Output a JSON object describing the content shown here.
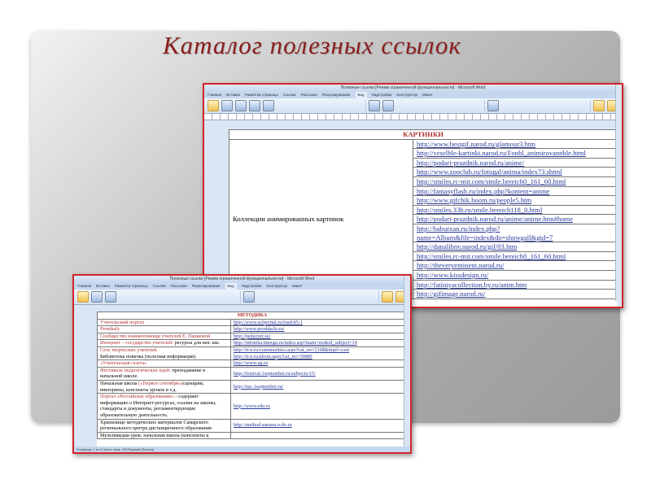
{
  "slide_title": "Каталог полезных ссылок",
  "window1": {
    "title": "Полезные ссылки [Режим ограниченной функциональности] - Microsoft Word",
    "tabs": [
      "Главная",
      "Вставка",
      "Разметка страницы",
      "Ссылки",
      "Рассылки",
      "Рецензирование",
      "Вид",
      "Надстройки",
      "Конструктор",
      "Макет"
    ],
    "active_tab": "Вид",
    "header": "КАРТИНКИ",
    "left_cell": "Коллекции анимированных картинок",
    "links": [
      "http://www.bestgif.narod.ru/glamour3.htm",
      "http://veselble-kartinki.narod.ru/Fonbl_animirovannble.html",
      "http://podari-prazdnik.narod.ru/anime/",
      "http://www.zooclub.ru/fotogal/anima/index73.shtml",
      "http://smiles.rc-mir.com/smile.bereich0_161_60.html",
      "http://fantasyflash.ru/index.php?kontent=anime",
      "http://www.gifchik.boom.ru/people5.htm",
      "http://smiles.33b.ru/smile.bereich118_0.html",
      "http://podari-prazdnik.narod.ru/anime/anime.htm#home",
      "http://baburxan.ru/index.php?name=Album&file=index&do=showgall&gid=7",
      "http://danalibnv.narod.ru/gif/03.htm",
      "http://smiles.rc-mir.com/smile.bereich0_161_60.html",
      "http://theveryeminent.narod.ru/",
      "http://www.kissdesign.ru/",
      "http://fatiniyacollection.by.ru/anim.htm",
      "http://gifimage.narod.ru/"
    ]
  },
  "window2": {
    "title": "Полезные ссылки [Режим ограниченной функциональности] - Microsoft Word",
    "tabs": [
      "Главная",
      "Вставка",
      "Разметка страницы",
      "Ссылки",
      "Рассылки",
      "Рецензирование",
      "Вид",
      "Надстройки",
      "Конструктор",
      "Макет"
    ],
    "active_tab": "Вид",
    "header": "МЕТОДИКА",
    "rows": [
      {
        "name": "Учительский портал",
        "desc": "",
        "link": "http://www.uchportal.ru/load/45-1"
      },
      {
        "name": "Pronikaly",
        "desc": "",
        "link": "http://www.proshkolu.ru/"
      },
      {
        "name": "Сообщество взаимопомощи учителей Е. Пашковой",
        "desc": "",
        "link": "http://pedsovet.su/"
      },
      {
        "name": "Интернет – государство учителей:",
        "desc": " ресурсы для нач. шк.",
        "link": "http://infoteka.intergu.ru/index.asp?main=res&id_subject=14"
      },
      {
        "name": "Сеть творческих учителей.",
        "desc": "Библиотека новичка (полезная информация).",
        "link": "http://it-n.ru/communities.aspx?cat_no=2168&tmpl=com",
        "link2": "http://it-n.ru/about.aspx?cat_no=39880"
      },
      {
        "name": "«Учительская газета»",
        "desc": "",
        "link": "http://www.ug.ru"
      },
      {
        "name": "Фестиваль педагогических идей:",
        "desc": " преподавание в начальной школе.",
        "link": "http://festival.1september.ru/subjects/15/"
      },
      {
        "name": "(«Первое сентября»)",
        "pre": "Начальная школа ",
        "desc": "сценарии, викторины, конспекты уроков и т.д.",
        "link": "http://nsc.1september.ru/"
      },
      {
        "name": "Портал «Российское образование»",
        "desc": " - содержит информацию о Интернет-ресурсах, ссылки на законы, стандарты и документы, регламентирующие образовательную деятельность.",
        "link": "http://www.edu.ru"
      },
      {
        "name": "",
        "desc": "Хранилище методических материалов Самарского регионального центра дистанционного образования",
        "link": "http://method.samara.rcdo.ru"
      },
      {
        "name": "",
        "desc": "Мультимедиа-урок: начальная школа (конспекты к",
        "link": ""
      }
    ],
    "status": "Страница: 1 из 4   Число слов: 763   Русский (Россия)"
  },
  "colors": {
    "accent_red": "#d2252a",
    "title": "#8b1e1e",
    "link": "#2a3a9a"
  }
}
